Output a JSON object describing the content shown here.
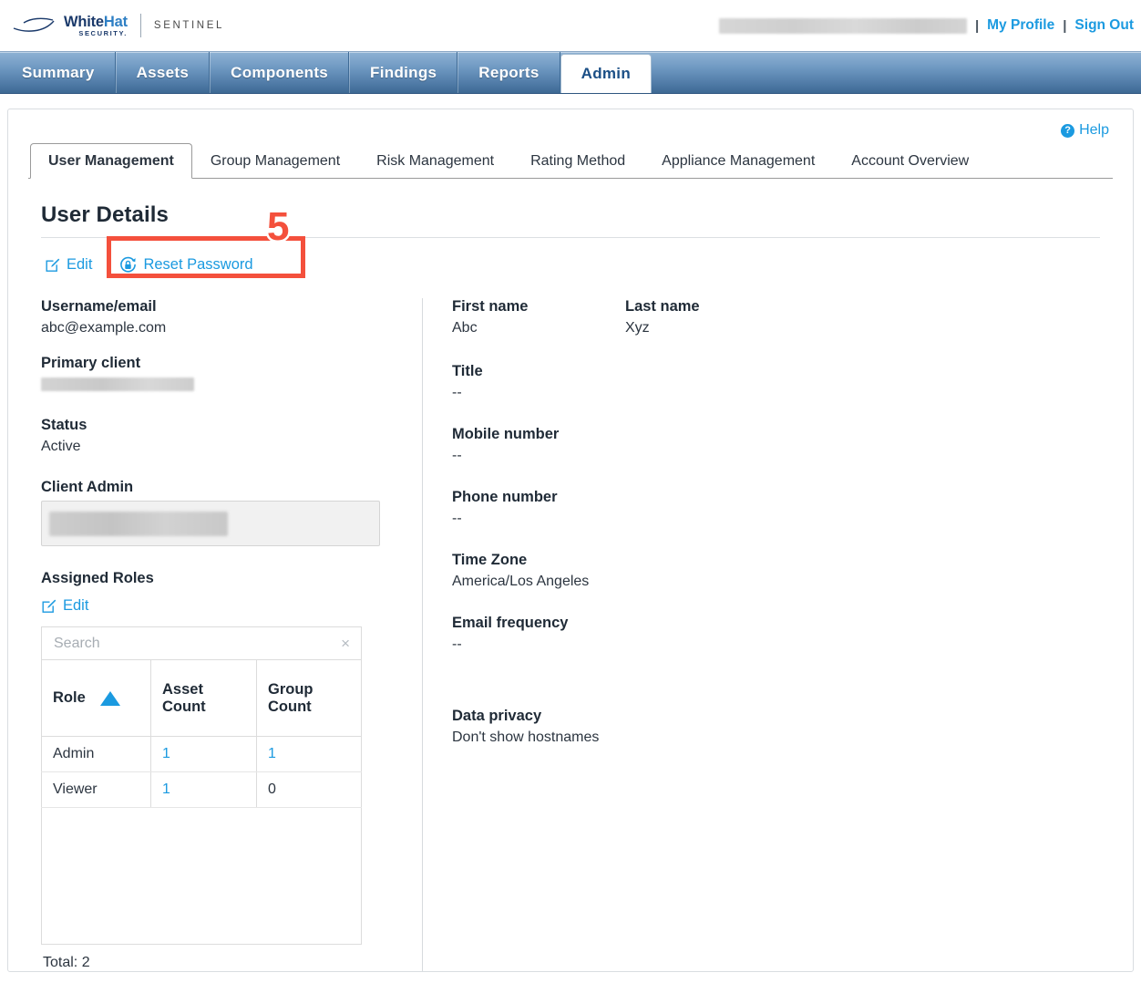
{
  "header": {
    "brand_primary": "White",
    "brand_primary_accent": "Hat",
    "brand_tagline": "SECURITY.",
    "brand_product": "SENTINEL",
    "user_name_redacted": "",
    "separator": "|",
    "my_profile_label": "My Profile",
    "sign_out_label": "Sign Out"
  },
  "main_nav": {
    "tabs": [
      {
        "label": "Summary",
        "active": false
      },
      {
        "label": "Assets",
        "active": false
      },
      {
        "label": "Components",
        "active": false
      },
      {
        "label": "Findings",
        "active": false
      },
      {
        "label": "Reports",
        "active": false
      },
      {
        "label": "Admin",
        "active": true
      }
    ]
  },
  "help": {
    "label": "Help",
    "icon_glyph": "?"
  },
  "sub_tabs": {
    "items": [
      {
        "label": "User Management",
        "active": true
      },
      {
        "label": "Group Management",
        "active": false
      },
      {
        "label": "Risk Management",
        "active": false
      },
      {
        "label": "Rating Method",
        "active": false
      },
      {
        "label": "Appliance Management",
        "active": false
      },
      {
        "label": "Account Overview",
        "active": false
      }
    ]
  },
  "user_details": {
    "title": "User Details",
    "actions": {
      "edit_label": "Edit",
      "reset_password_label": "Reset Password"
    },
    "annotation": {
      "number": "5",
      "target": "reset-password-link",
      "color": "#f4503c"
    },
    "left_fields": [
      {
        "label": "Username/email",
        "value": "abc@example.com",
        "redacted": false
      },
      {
        "label": "Primary client",
        "value": "",
        "redacted": true
      },
      {
        "label": "Status",
        "value": "Active",
        "redacted": false
      },
      {
        "label": "Client Admin",
        "value": "",
        "redacted": true
      }
    ],
    "right_fields": [
      {
        "label": "First name",
        "value": "Abc"
      },
      {
        "label": "Last name",
        "value": "Xyz"
      },
      {
        "label": "Title",
        "value": "--"
      },
      {
        "label": "Mobile number",
        "value": "--"
      },
      {
        "label": "Phone number",
        "value": "--"
      },
      {
        "label": "Time Zone",
        "value": "America/Los Angeles"
      },
      {
        "label": "Email frequency",
        "value": "--"
      },
      {
        "label": "Data privacy",
        "value": "Don't show hostnames"
      }
    ]
  },
  "assigned_roles": {
    "title": "Assigned Roles",
    "edit_label": "Edit",
    "search_placeholder": "Search",
    "search_value": "",
    "clear_glyph": "×",
    "columns": [
      {
        "label": "Role",
        "sorted": true,
        "sort_direction": "asc"
      },
      {
        "label": "Asset Count",
        "sorted": false
      },
      {
        "label": "Group Count",
        "sorted": false
      }
    ],
    "rows": [
      {
        "role": "Admin",
        "asset_count": "1",
        "asset_link": true,
        "group_count": "1",
        "group_link": true
      },
      {
        "role": "Viewer",
        "asset_count": "1",
        "asset_link": true,
        "group_count": "0",
        "group_link": false
      }
    ],
    "total_label": "Total: 2"
  },
  "colors": {
    "link_blue": "#1b9ae0",
    "nav_blue_top": "#8fb2d4",
    "nav_blue_bottom": "#3d6993",
    "annotation_red": "#f4503c",
    "text_dark": "#1f2a36"
  }
}
